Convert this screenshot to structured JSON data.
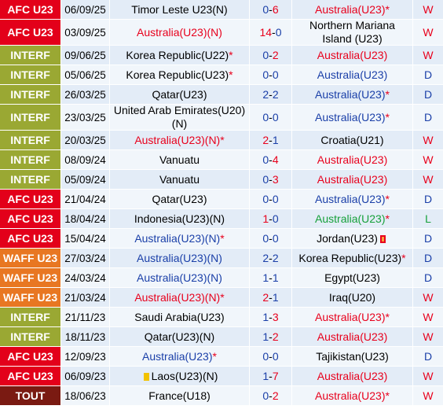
{
  "colors": {
    "AFC U23": "#e3001a",
    "INTERF": "#9aa833",
    "WAFF U23": "#e87722",
    "TOUT": "#7a1a12"
  },
  "rows": [
    {
      "comp": "AFC U23",
      "date": "06/09/25",
      "home": "Timor Leste U23(N)",
      "home_color": "black",
      "home_star": "",
      "score_h": "0",
      "score_a": "6",
      "sh_color": "blue",
      "sa_color": "red",
      "away": "Australia(U23)",
      "away_color": "red",
      "away_star": "*",
      "result": "W",
      "res_color": "red"
    },
    {
      "comp": "AFC U23",
      "date": "03/09/25",
      "home": "Australia(U23)(N)",
      "home_color": "red",
      "home_star": "",
      "score_h": "14",
      "score_a": "0",
      "sh_color": "red",
      "sa_color": "blue",
      "away": "Northern Mariana Island (U23)",
      "away_color": "black",
      "away_star": "",
      "result": "W",
      "res_color": "red"
    },
    {
      "comp": "INTERF",
      "date": "09/06/25",
      "home": "Korea Republic(U22)",
      "home_color": "black",
      "home_star": "*",
      "score_h": "0",
      "score_a": "2",
      "sh_color": "blue",
      "sa_color": "red",
      "away": "Australia(U23)",
      "away_color": "red",
      "away_star": "",
      "result": "W",
      "res_color": "red"
    },
    {
      "comp": "INTERF",
      "date": "05/06/25",
      "home": "Korea Republic(U23)",
      "home_color": "black",
      "home_star": "*",
      "score_h": "0",
      "score_a": "0",
      "sh_color": "blue",
      "sa_color": "blue",
      "away": "Australia(U23)",
      "away_color": "blue",
      "away_star": "",
      "result": "D",
      "res_color": "blue"
    },
    {
      "comp": "INTERF",
      "date": "26/03/25",
      "home": "Qatar(U23)",
      "home_color": "black",
      "home_star": "",
      "score_h": "2",
      "score_a": "2",
      "sh_color": "blue",
      "sa_color": "blue",
      "away": "Australia(U23)",
      "away_color": "blue",
      "away_star": "*",
      "result": "D",
      "res_color": "blue"
    },
    {
      "comp": "INTERF",
      "date": "23/03/25",
      "home": "United Arab Emirates(U20)(N)",
      "home_color": "black",
      "home_star": "",
      "score_h": "0",
      "score_a": "0",
      "sh_color": "blue",
      "sa_color": "blue",
      "away": "Australia(U23)",
      "away_color": "blue",
      "away_star": "*",
      "result": "D",
      "res_color": "blue"
    },
    {
      "comp": "INTERF",
      "date": "20/03/25",
      "home": "Australia(U23)(N)",
      "home_color": "red",
      "home_star": "*",
      "score_h": "2",
      "score_a": "1",
      "sh_color": "red",
      "sa_color": "blue",
      "away": "Croatia(U21)",
      "away_color": "black",
      "away_star": "",
      "result": "W",
      "res_color": "red"
    },
    {
      "comp": "INTERF",
      "date": "08/09/24",
      "home": "Vanuatu",
      "home_color": "black",
      "home_star": "",
      "score_h": "0",
      "score_a": "4",
      "sh_color": "blue",
      "sa_color": "red",
      "away": "Australia(U23)",
      "away_color": "red",
      "away_star": "",
      "result": "W",
      "res_color": "red"
    },
    {
      "comp": "INTERF",
      "date": "05/09/24",
      "home": "Vanuatu",
      "home_color": "black",
      "home_star": "",
      "score_h": "0",
      "score_a": "3",
      "sh_color": "blue",
      "sa_color": "red",
      "away": "Australia(U23)",
      "away_color": "red",
      "away_star": "",
      "result": "W",
      "res_color": "red"
    },
    {
      "comp": "AFC U23",
      "date": "21/04/24",
      "home": "Qatar(U23)",
      "home_color": "black",
      "home_star": "",
      "score_h": "0",
      "score_a": "0",
      "sh_color": "blue",
      "sa_color": "blue",
      "away": "Australia(U23)",
      "away_color": "blue",
      "away_star": "*",
      "result": "D",
      "res_color": "blue"
    },
    {
      "comp": "AFC U23",
      "date": "18/04/24",
      "home": "Indonesia(U23)(N)",
      "home_color": "black",
      "home_star": "",
      "score_h": "1",
      "score_a": "0",
      "sh_color": "red",
      "sa_color": "blue",
      "away": "Australia(U23)",
      "away_color": "green",
      "away_star": "*",
      "result": "L",
      "res_color": "green"
    },
    {
      "comp": "AFC U23",
      "date": "15/04/24",
      "home": "Australia(U23)(N)",
      "home_color": "blue",
      "home_star": "*",
      "score_h": "0",
      "score_a": "0",
      "sh_color": "blue",
      "sa_color": "blue",
      "away": "Jordan(U23)",
      "away_color": "black",
      "away_star": "",
      "away_card": "red",
      "result": "D",
      "res_color": "blue"
    },
    {
      "comp": "WAFF U23",
      "date": "27/03/24",
      "home": "Australia(U23)(N)",
      "home_color": "blue",
      "home_star": "",
      "score_h": "2",
      "score_a": "2",
      "sh_color": "blue",
      "sa_color": "blue",
      "away": "Korea Republic(U23)",
      "away_color": "black",
      "away_star": "*",
      "result": "D",
      "res_color": "blue"
    },
    {
      "comp": "WAFF U23",
      "date": "24/03/24",
      "home": "Australia(U23)(N)",
      "home_color": "blue",
      "home_star": "",
      "score_h": "1",
      "score_a": "1",
      "sh_color": "blue",
      "sa_color": "blue",
      "away": "Egypt(U23)",
      "away_color": "black",
      "away_star": "",
      "result": "D",
      "res_color": "blue"
    },
    {
      "comp": "WAFF U23",
      "date": "21/03/24",
      "home": "Australia(U23)(N)",
      "home_color": "red",
      "home_star": "*",
      "score_h": "2",
      "score_a": "1",
      "sh_color": "red",
      "sa_color": "blue",
      "away": "Iraq(U20)",
      "away_color": "black",
      "away_star": "",
      "result": "W",
      "res_color": "red"
    },
    {
      "comp": "INTERF",
      "date": "21/11/23",
      "home": "Saudi Arabia(U23)",
      "home_color": "black",
      "home_star": "",
      "score_h": "1",
      "score_a": "3",
      "sh_color": "blue",
      "sa_color": "red",
      "away": "Australia(U23)",
      "away_color": "red",
      "away_star": "*",
      "result": "W",
      "res_color": "red"
    },
    {
      "comp": "INTERF",
      "date": "18/11/23",
      "home": "Qatar(U23)(N)",
      "home_color": "black",
      "home_star": "",
      "score_h": "1",
      "score_a": "2",
      "sh_color": "blue",
      "sa_color": "red",
      "away": "Australia(U23)",
      "away_color": "red",
      "away_star": "",
      "result": "W",
      "res_color": "red"
    },
    {
      "comp": "AFC U23",
      "date": "12/09/23",
      "home": "Australia(U23)",
      "home_color": "blue",
      "home_star": "*",
      "score_h": "0",
      "score_a": "0",
      "sh_color": "blue",
      "sa_color": "blue",
      "away": "Tajikistan(U23)",
      "away_color": "black",
      "away_star": "",
      "result": "D",
      "res_color": "blue"
    },
    {
      "comp": "AFC U23",
      "date": "06/09/23",
      "home": "Laos(U23)(N)",
      "home_color": "black",
      "home_star": "",
      "home_card": "yellow",
      "score_h": "1",
      "score_a": "7",
      "sh_color": "blue",
      "sa_color": "red",
      "away": "Australia(U23)",
      "away_color": "red",
      "away_star": "",
      "result": "W",
      "res_color": "red"
    },
    {
      "comp": "TOUT",
      "date": "18/06/23",
      "home": "France(U18)",
      "home_color": "black",
      "home_star": "",
      "score_h": "0",
      "score_a": "2",
      "sh_color": "blue",
      "sa_color": "red",
      "away": "Australia(U23)",
      "away_color": "red",
      "away_star": "*",
      "result": "W",
      "res_color": "red"
    }
  ]
}
